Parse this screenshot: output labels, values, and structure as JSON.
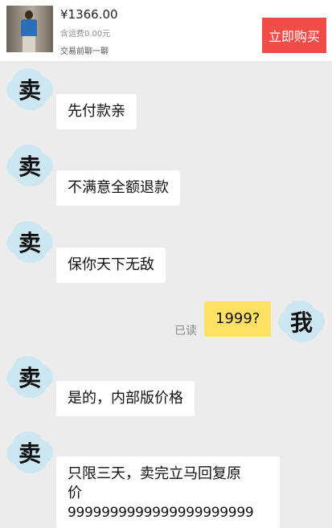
{
  "header": {
    "price": "¥1366.00",
    "shipping": "含运费0.00元",
    "note": "交易前聊一聊",
    "buy_button": "立即购买"
  },
  "colors": {
    "buy_button": "#f04c48",
    "my_bubble": "#fde064",
    "background": "#ececec",
    "avatar_blob": "#cce7f2"
  },
  "messages": [
    {
      "sender": "卖",
      "text": "先付款亲"
    },
    {
      "sender": "卖",
      "text": "不满意全额退款"
    },
    {
      "sender": "卖",
      "text": "保你天下无敌"
    },
    {
      "sender": "我",
      "text": "1999?",
      "status": "已读"
    },
    {
      "sender": "卖",
      "text": "是的，内部版价格"
    },
    {
      "sender": "卖",
      "text_line1": "只限三天，卖完立马回复原",
      "text_line2": "价",
      "text_line3": "9999999999999999999999"
    }
  ]
}
